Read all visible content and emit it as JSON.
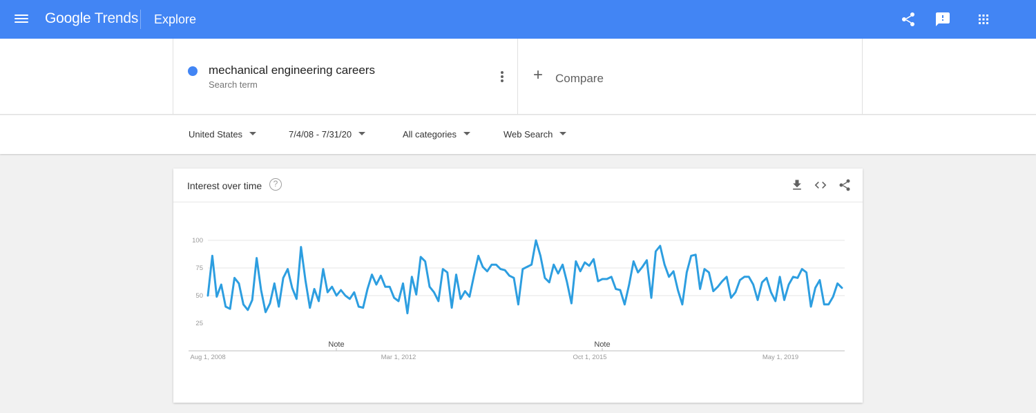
{
  "header": {
    "logo_google": "Google",
    "logo_trends": "Trends",
    "section": "Explore",
    "icons": [
      "menu-icon",
      "share-icon",
      "feedback-icon",
      "apps-icon"
    ],
    "color": "#4285f4"
  },
  "search_term": {
    "name": "mechanical engineering careers",
    "type": "Search term",
    "dot_color": "#4285f4"
  },
  "compare": {
    "plus": "+",
    "label": "Compare"
  },
  "filters": {
    "region": "United States",
    "date_range": "7/4/08 - 7/31/20",
    "category": "All categories",
    "search_type": "Web Search"
  },
  "card": {
    "title": "Interest over time",
    "help": "?",
    "icons": [
      "download-icon",
      "embed-icon",
      "share-icon"
    ]
  },
  "chart_data": {
    "type": "line",
    "title": "Interest over time",
    "line_color": "#2d9ee0",
    "ylim": [
      25,
      100
    ],
    "yticks": [
      100,
      75,
      50,
      25
    ],
    "xtick_labels": [
      "Aug 1, 2008",
      "Mar 1, 2012",
      "Oct 1, 2015",
      "May 1, 2019"
    ],
    "notes": [
      "Note",
      "Note"
    ],
    "grid": true,
    "x_range": [
      "2008-07",
      "2020-07"
    ],
    "series": [
      {
        "values": [
          50,
          86,
          49,
          60,
          40,
          38,
          66,
          61,
          42,
          37,
          46,
          84,
          55,
          35,
          43,
          61,
          40,
          66,
          74,
          57,
          47,
          94,
          64,
          39,
          56,
          45,
          74,
          53,
          58,
          50,
          55,
          50,
          47,
          53,
          40,
          39,
          56,
          69,
          60,
          68,
          58,
          58,
          48,
          45,
          61,
          34,
          67,
          51,
          85,
          81,
          58,
          53,
          45,
          74,
          71,
          39,
          69,
          47,
          54,
          49,
          68,
          86,
          76,
          72,
          78,
          78,
          74,
          73,
          68,
          66,
          42,
          74,
          76,
          78,
          100,
          86,
          66,
          62,
          78,
          70,
          78,
          62,
          43,
          81,
          72,
          80,
          77,
          83,
          63,
          65,
          65,
          67,
          56,
          55,
          42,
          60,
          81,
          71,
          76,
          82,
          48,
          90,
          95,
          78,
          67,
          72,
          55,
          42,
          71,
          86,
          87,
          56,
          74,
          71,
          54,
          58,
          63,
          67,
          48,
          53,
          64,
          67,
          67,
          60,
          46,
          62,
          66,
          53,
          45,
          67,
          46,
          60,
          67,
          66,
          74,
          71,
          40,
          57,
          64,
          42,
          42,
          49,
          61,
          57
        ]
      }
    ]
  }
}
